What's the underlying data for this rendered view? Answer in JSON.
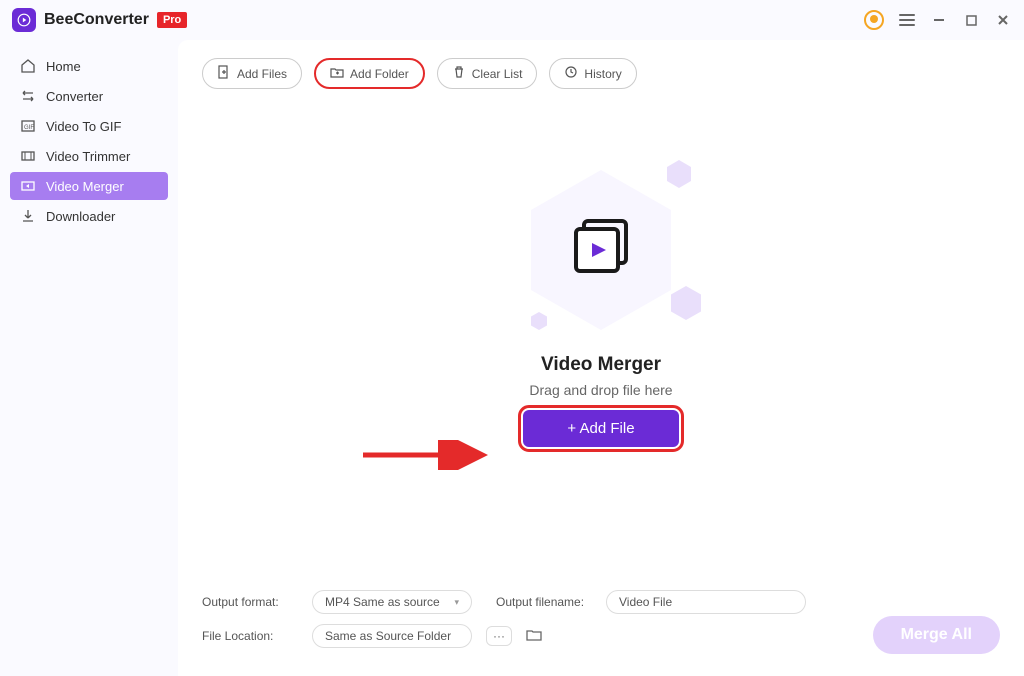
{
  "app": {
    "name": "BeeConverter",
    "badge": "Pro"
  },
  "sidebar": {
    "items": [
      {
        "label": "Home"
      },
      {
        "label": "Converter"
      },
      {
        "label": "Video To GIF"
      },
      {
        "label": "Video Trimmer"
      },
      {
        "label": "Video Merger"
      },
      {
        "label": "Downloader"
      }
    ]
  },
  "toolbar": {
    "add_files": "Add Files",
    "add_folder": "Add Folder",
    "clear_list": "Clear List",
    "history": "History"
  },
  "dropzone": {
    "heading": "Video Merger",
    "hint": "Drag and drop file here",
    "add_file_btn": "+ Add File"
  },
  "bottom": {
    "output_format_label": "Output format:",
    "output_format_value": "MP4 Same as source",
    "output_filename_label": "Output filename:",
    "output_filename_value": "Video File",
    "file_location_label": "File Location:",
    "file_location_value": "Same as Source Folder",
    "merge_btn": "Merge All"
  }
}
